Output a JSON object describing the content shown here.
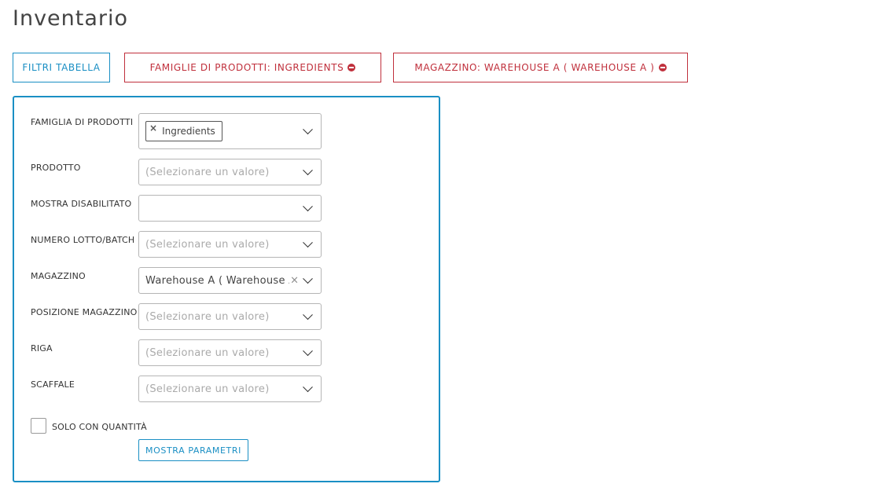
{
  "page": {
    "title": "Inventario"
  },
  "toolbar": {
    "filter_table_label": "FILTRI TABELLA",
    "active_filters": [
      {
        "label": "FAMIGLIE DI PRODOTTI: INGREDIENTS"
      },
      {
        "label": "MAGAZZINO: WAREHOUSE A ( WAREHOUSE A )"
      }
    ]
  },
  "form": {
    "fields": [
      {
        "label": "FAMIGLIA DI PRODOTTI",
        "tag": "Ingredients"
      },
      {
        "label": "PRODOTTO",
        "placeholder": "(Selezionare un valore)"
      },
      {
        "label": "MOSTRA DISABILITATO",
        "value": ""
      },
      {
        "label": "NUMERO LOTTO/BATCH",
        "placeholder": "(Selezionare un valore)"
      },
      {
        "label": "MAGAZZINO",
        "value": "Warehouse A ( Warehouse A )"
      },
      {
        "label": "POSIZIONE MAGAZZINO",
        "placeholder": "(Selezionare un valore)"
      },
      {
        "label": "RIGA",
        "placeholder": "(Selezionare un valore)"
      },
      {
        "label": "SCAFFALE",
        "placeholder": "(Selezionare un valore)"
      }
    ],
    "only_with_quantity_label": "SOLO CON QUANTITÀ",
    "only_with_quantity_checked": false,
    "show_params_label": "MOSTRA PARAMETRI"
  },
  "colors": {
    "accent_blue": "#1a8fc4",
    "filter_red": "#c0303c"
  },
  "icons": {
    "tag_remove": "close-icon",
    "filter_remove": "minus-circle-icon",
    "dropdown": "chevron-down-icon"
  }
}
